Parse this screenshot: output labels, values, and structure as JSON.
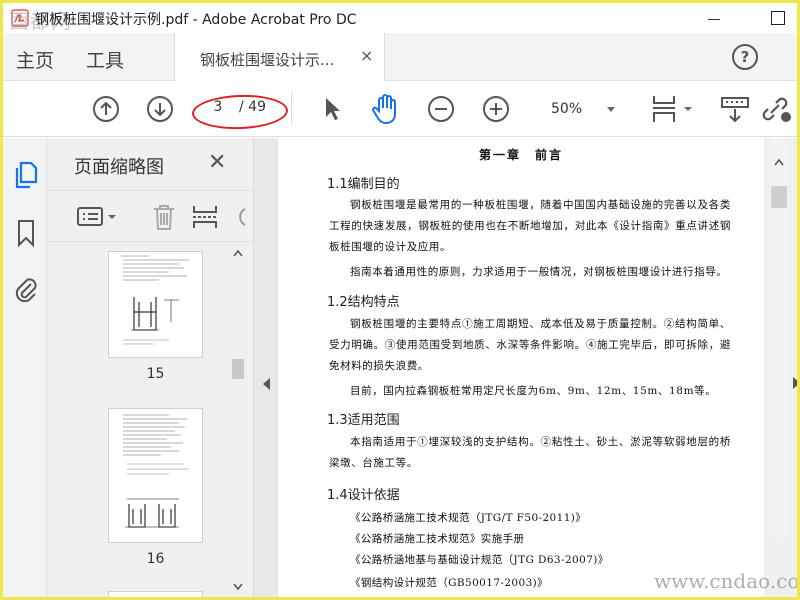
{
  "window": {
    "title": "钢板桩围堰设计示例.pdf - Adobe Acrobat Pro DC",
    "watermark_left": "酉都网"
  },
  "tabs": {
    "home": "主页",
    "tools": "工具",
    "document": "钢板桩围堰设计示...",
    "close": "×",
    "help": "?"
  },
  "toolbar": {
    "current_page": "3",
    "total_pages": "/ 49",
    "zoom": "50%"
  },
  "panel": {
    "title": "页面缩略图",
    "close": "✕",
    "thumbnails": [
      {
        "label": "15"
      },
      {
        "label": "16"
      }
    ]
  },
  "document": {
    "chapter_title": "第一章　前言",
    "sections": [
      {
        "heading": "1.1编制目的",
        "paragraphs": [
          "钢板桩围堰是最常用的一种板桩围堰，随着中国国内基础设施的完善以及各类工程的快速发展，钢板桩的使用也在不断地增加，对此本《设计指南》重点讲述钢板桩围堰的设计及应用。",
          "指南本着通用性的原则，力求适用于一般情况，对钢板桩围堰设计进行指导。"
        ]
      },
      {
        "heading": "1.2结构特点",
        "paragraphs": [
          "钢板桩围堰的主要特点①施工周期短、成本低及易于质量控制。②结构简单、受力明确。③使用范围受到地质、水深等条件影响。④施工完毕后，即可拆除，避免材料的损失浪费。",
          "目前，国内拉森钢板桩常用定尺长度为6m、9m、12m、15m、18m等。"
        ]
      },
      {
        "heading": "1.3适用范围",
        "paragraphs": [
          "本指南适用于①埋深较浅的支护结构。②粘性土、砂土、淤泥等软弱地层的桥梁墩、台施工等。"
        ]
      },
      {
        "heading": "1.4设计依据",
        "references": [
          "《公路桥涵施工技术规范（JTG/T F50-2011)》",
          "《公路桥涵施工技术规范》实施手册",
          "《公路桥涵地基与基础设计规范（JTG D63-2007)》",
          "《钢结构设计规范（GB50017-2003)》"
        ]
      }
    ]
  },
  "watermark": "www.cndao.com",
  "colors": {
    "frame": "#f0e84a",
    "accent_blue": "#1473e6",
    "highlight_red": "#e02020"
  }
}
